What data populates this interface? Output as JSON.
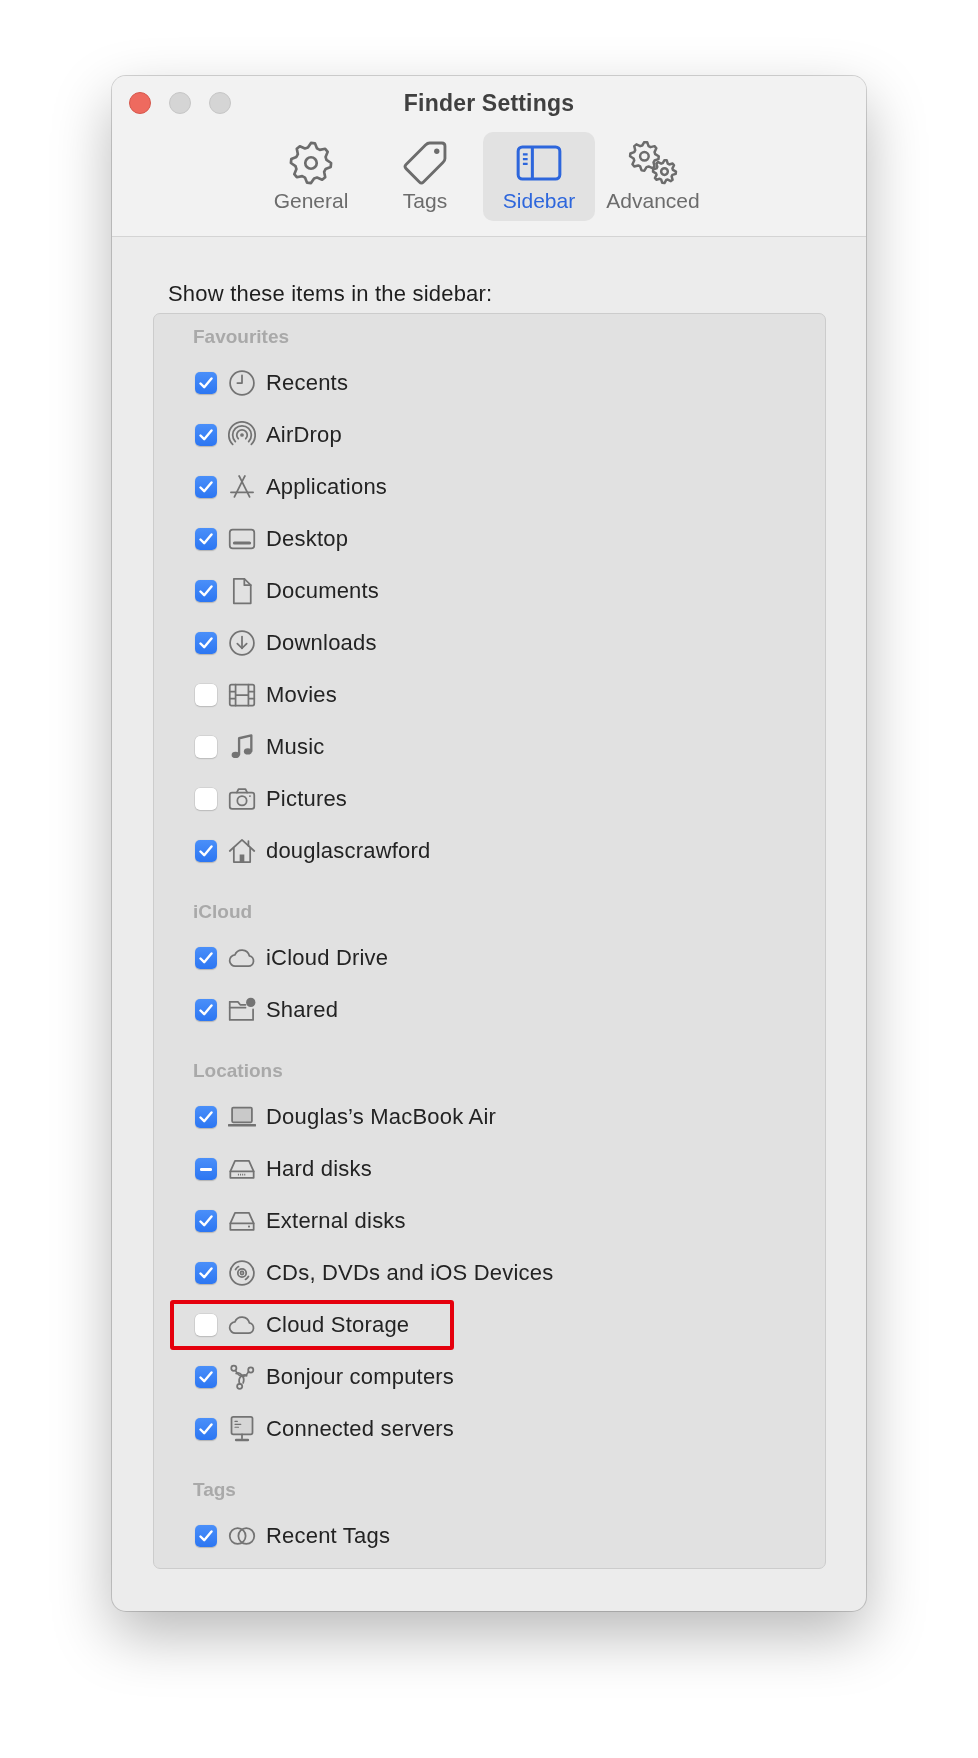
{
  "window": {
    "title": "Finder Settings",
    "buttons": [
      {
        "kind": "close",
        "disabled": false
      },
      {
        "kind": "minimize",
        "disabled": true
      },
      {
        "kind": "zoom",
        "disabled": true
      }
    ]
  },
  "tabs": [
    {
      "label": "General",
      "selected": false
    },
    {
      "label": "Tags",
      "selected": false
    },
    {
      "label": "Sidebar",
      "selected": true
    },
    {
      "label": "Advanced",
      "selected": false
    }
  ],
  "prompt": "Show these items in the sidebar:",
  "sections": [
    {
      "title": "Favourites",
      "items": [
        {
          "label": "Recents",
          "checked": true,
          "mixed": false,
          "highlighted": false
        },
        {
          "label": "AirDrop",
          "checked": true,
          "mixed": false,
          "highlighted": false
        },
        {
          "label": "Applications",
          "checked": true,
          "mixed": false,
          "highlighted": false
        },
        {
          "label": "Desktop",
          "checked": true,
          "mixed": false,
          "highlighted": false
        },
        {
          "label": "Documents",
          "checked": true,
          "mixed": false,
          "highlighted": false
        },
        {
          "label": "Downloads",
          "checked": true,
          "mixed": false,
          "highlighted": false
        },
        {
          "label": "Movies",
          "checked": false,
          "mixed": false,
          "highlighted": false
        },
        {
          "label": "Music",
          "checked": false,
          "mixed": false,
          "highlighted": false
        },
        {
          "label": "Pictures",
          "checked": false,
          "mixed": false,
          "highlighted": false
        },
        {
          "label": "douglascrawford",
          "checked": true,
          "mixed": false,
          "highlighted": false
        }
      ]
    },
    {
      "title": "iCloud",
      "items": [
        {
          "label": "iCloud Drive",
          "checked": true,
          "mixed": false,
          "highlighted": false
        },
        {
          "label": "Shared",
          "checked": true,
          "mixed": false,
          "highlighted": false
        }
      ]
    },
    {
      "title": "Locations",
      "items": [
        {
          "label": "Douglas’s MacBook Air",
          "checked": true,
          "mixed": false,
          "highlighted": false
        },
        {
          "label": "Hard disks",
          "checked": true,
          "mixed": true,
          "highlighted": false
        },
        {
          "label": "External disks",
          "checked": true,
          "mixed": false,
          "highlighted": false
        },
        {
          "label": "CDs, DVDs and iOS Devices",
          "checked": true,
          "mixed": false,
          "highlighted": false
        },
        {
          "label": "Cloud Storage",
          "checked": false,
          "mixed": false,
          "highlighted": true
        },
        {
          "label": "Bonjour computers",
          "checked": true,
          "mixed": false,
          "highlighted": false
        },
        {
          "label": "Connected servers",
          "checked": true,
          "mixed": false,
          "highlighted": false
        }
      ]
    },
    {
      "title": "Tags",
      "items": [
        {
          "label": "Recent Tags",
          "checked": true,
          "mixed": false,
          "highlighted": false
        }
      ]
    }
  ]
}
